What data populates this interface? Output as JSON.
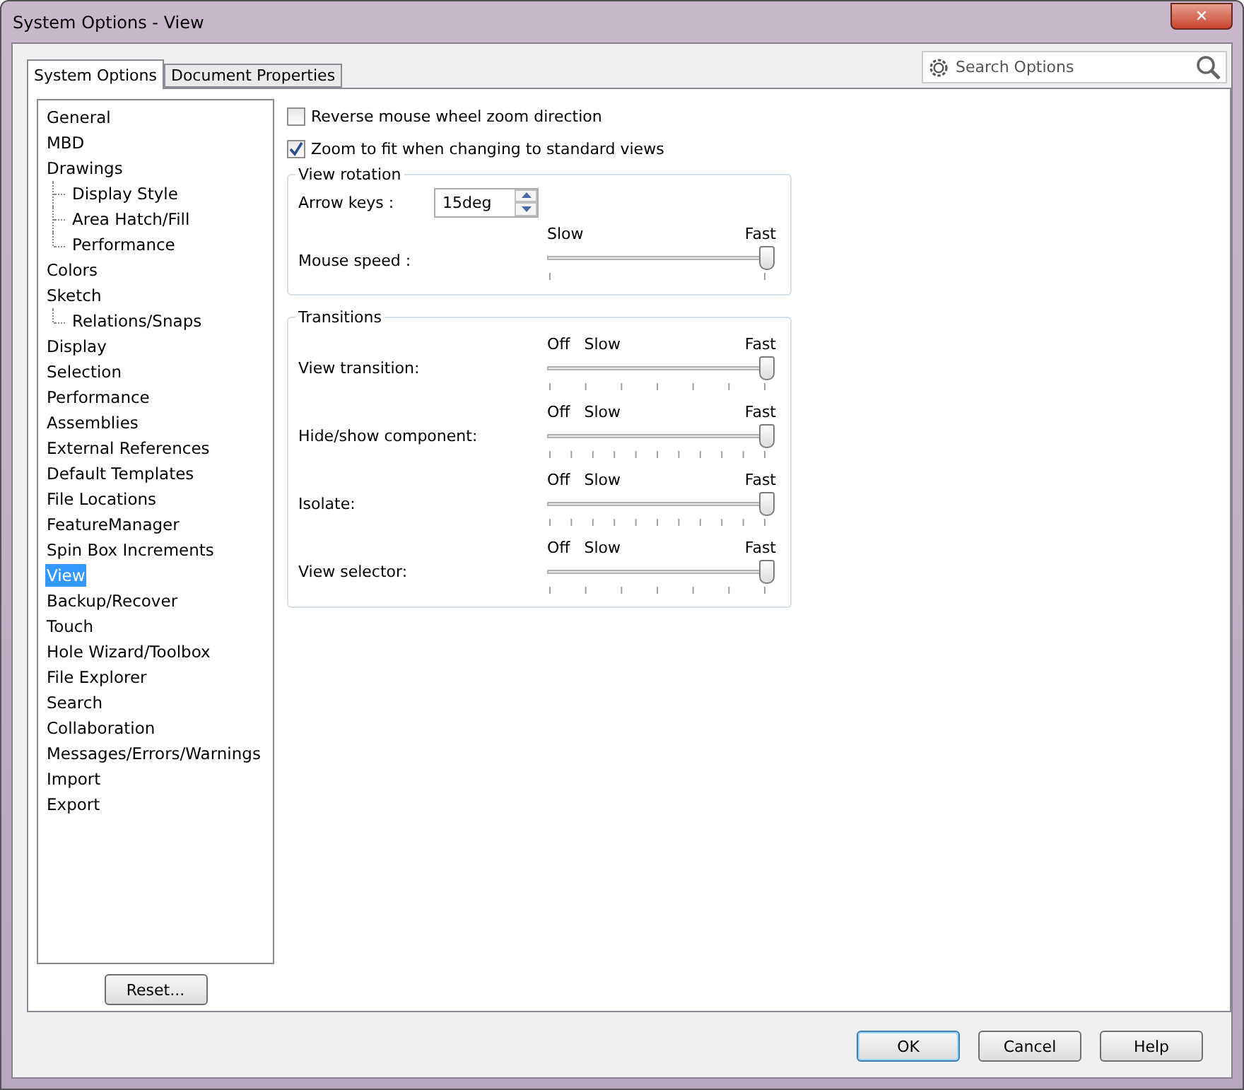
{
  "window": {
    "title": "System Options - View",
    "close": "✕"
  },
  "tabs": [
    {
      "label": "System Options",
      "selected": true
    },
    {
      "label": "Document Properties",
      "selected": false
    }
  ],
  "search": {
    "placeholder": "Search Options"
  },
  "tree": [
    {
      "label": "General",
      "selected": false
    },
    {
      "label": "MBD",
      "selected": false
    },
    {
      "label": "Drawings",
      "selected": false,
      "children": [
        {
          "label": "Display Style",
          "selected": false
        },
        {
          "label": "Area Hatch/Fill",
          "selected": false
        },
        {
          "label": "Performance",
          "selected": false
        }
      ]
    },
    {
      "label": "Colors",
      "selected": false
    },
    {
      "label": "Sketch",
      "selected": false,
      "children": [
        {
          "label": "Relations/Snaps",
          "selected": false
        }
      ]
    },
    {
      "label": "Display",
      "selected": false
    },
    {
      "label": "Selection",
      "selected": false
    },
    {
      "label": "Performance",
      "selected": false
    },
    {
      "label": "Assemblies",
      "selected": false
    },
    {
      "label": "External References",
      "selected": false
    },
    {
      "label": "Default Templates",
      "selected": false
    },
    {
      "label": "File Locations",
      "selected": false
    },
    {
      "label": "FeatureManager",
      "selected": false
    },
    {
      "label": "Spin Box Increments",
      "selected": false
    },
    {
      "label": "View",
      "selected": true
    },
    {
      "label": "Backup/Recover",
      "selected": false
    },
    {
      "label": "Touch",
      "selected": false
    },
    {
      "label": "Hole Wizard/Toolbox",
      "selected": false
    },
    {
      "label": "File Explorer",
      "selected": false
    },
    {
      "label": "Search",
      "selected": false
    },
    {
      "label": "Collaboration",
      "selected": false
    },
    {
      "label": "Messages/Errors/Warnings",
      "selected": false
    },
    {
      "label": "Import",
      "selected": false
    },
    {
      "label": "Export",
      "selected": false
    }
  ],
  "reset_button": "Reset...",
  "options": [
    {
      "label": "Reverse mouse wheel zoom direction",
      "checked": false
    },
    {
      "label": "Zoom to fit when changing to standard views",
      "checked": true
    }
  ],
  "view_rotation": {
    "title": "View rotation",
    "arrow_keys": {
      "label": "Arrow keys :",
      "value": "15deg"
    },
    "mouse_speed": {
      "label": "Mouse speed :",
      "scale_labels": [
        "Slow",
        "Fast"
      ],
      "level": 1,
      "kind": "ends"
    }
  },
  "transitions": {
    "title": "Transitions",
    "sliders": [
      {
        "label": "View transition:",
        "scale_labels": [
          "Off",
          "Slow",
          "Fast"
        ],
        "level": 1,
        "kind": "coarse"
      },
      {
        "label": "Hide/show component:",
        "scale_labels": [
          "Off",
          "Slow",
          "Fast"
        ],
        "level": 1,
        "kind": "fine"
      },
      {
        "label": "Isolate:",
        "scale_labels": [
          "Off",
          "Slow",
          "Fast"
        ],
        "level": 1,
        "kind": "fine"
      },
      {
        "label": "View selector:",
        "scale_labels": [
          "Off",
          "Slow",
          "Fast"
        ],
        "level": 1,
        "kind": "coarse"
      }
    ]
  },
  "buttons": [
    "OK",
    "Cancel",
    "Help"
  ]
}
